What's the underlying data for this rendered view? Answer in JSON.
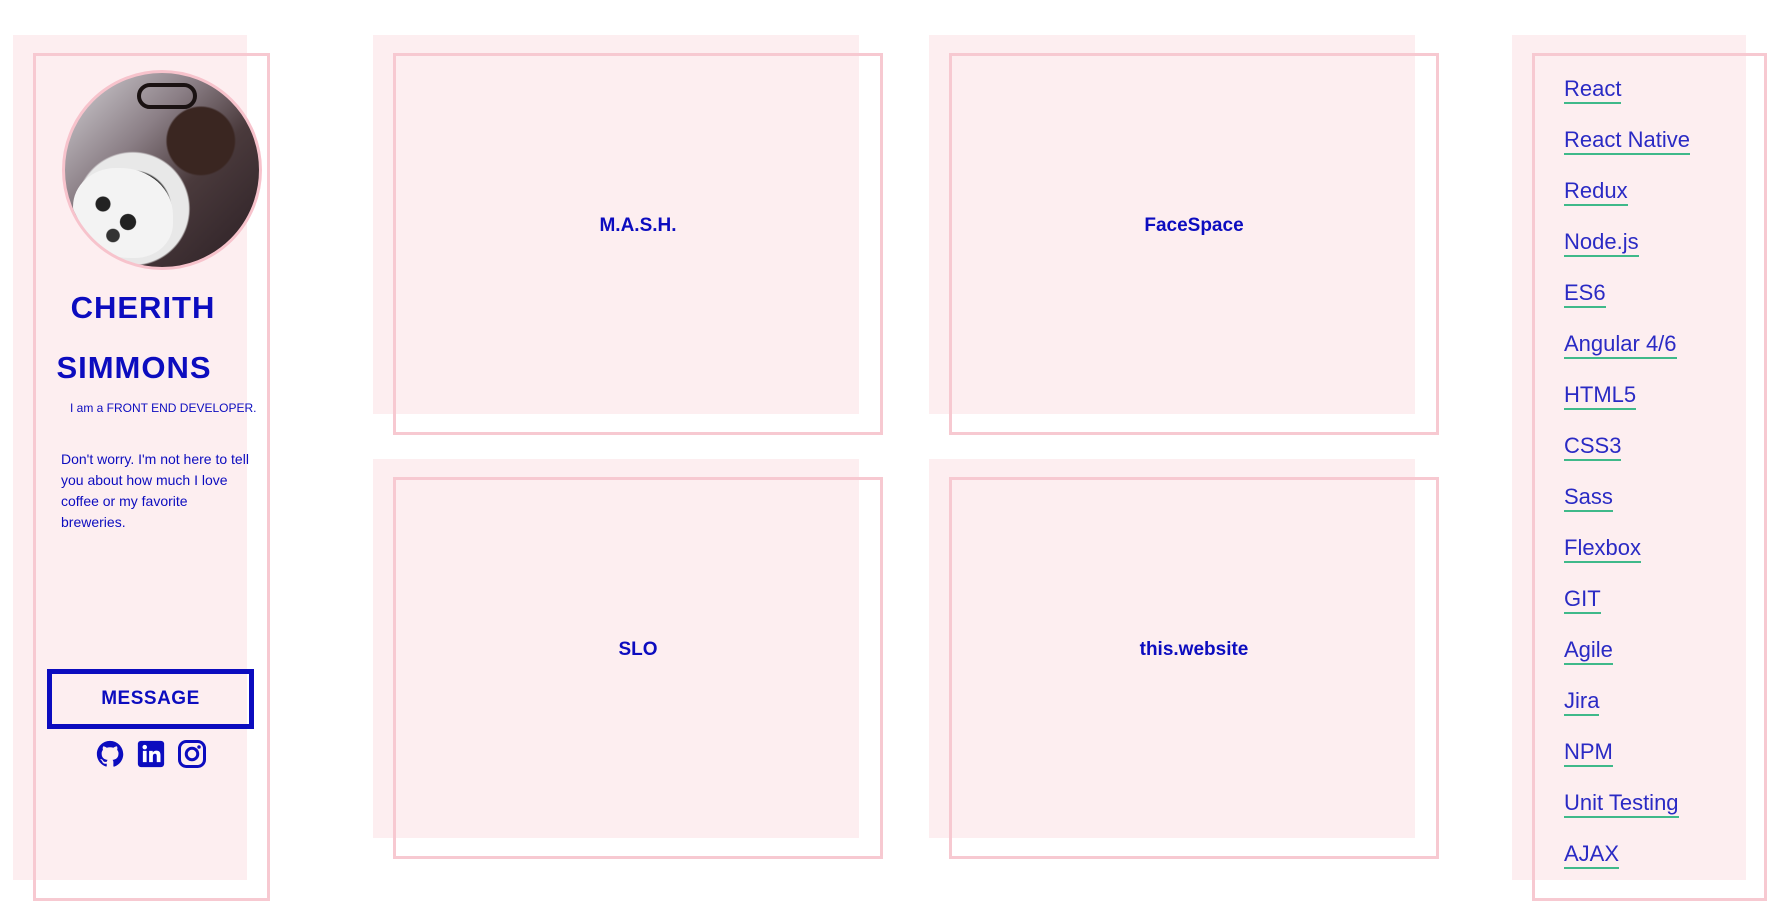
{
  "profile": {
    "first_name": "CHERITH",
    "last_name": "SIMMONS",
    "tagline": "I am a FRONT END DEVELOPER.",
    "bio": "Don't worry. I'm not here to tell you about how much I love coffee or my favorite breweries.",
    "message_label": "MESSAGE",
    "socials": [
      "github-icon",
      "linkedin-icon",
      "instagram-icon"
    ]
  },
  "projects": [
    {
      "title": "M.A.S.H."
    },
    {
      "title": "FaceSpace"
    },
    {
      "title": "SLO"
    },
    {
      "title": "this.website"
    }
  ],
  "skills": [
    "React",
    "React Native",
    "Redux",
    "Node.js",
    "ES6",
    "Angular 4/6",
    "HTML5",
    "CSS3",
    "Sass",
    "Flexbox",
    "GIT",
    "Agile",
    "Jira",
    "NPM",
    "Unit Testing",
    "AJAX"
  ],
  "colors": {
    "accent": "#0c0cbf",
    "panel": "#fdeef0",
    "panel_border": "#f7c9d1",
    "link_underline": "#3fb98a"
  }
}
